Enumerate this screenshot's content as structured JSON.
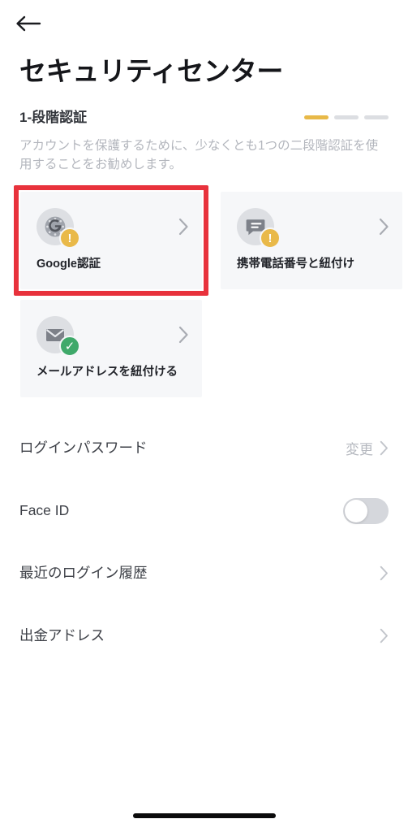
{
  "navbar": {
    "back_icon": "arrow-left-icon"
  },
  "header": {
    "title": "セキュリティセンター"
  },
  "section": {
    "title": "1-段階認証",
    "description": "アカウントを保護するために、少なくとも1つの二段階認証を使用することをお勧めします。",
    "steps": [
      {
        "state": "active",
        "color": "#e8b948"
      },
      {
        "state": "inactive",
        "color": "#dcdee2"
      },
      {
        "state": "inactive",
        "color": "#dcdee2"
      }
    ]
  },
  "auth_cards": [
    {
      "label": "Google認証",
      "icon": "authenticator-icon",
      "badge": "warning",
      "badge_mark": "!",
      "badge_color": "#e9b949",
      "highlighted": true
    },
    {
      "label": "携帯電話番号と紐付け",
      "icon": "chat-bubble-icon",
      "badge": "warning",
      "badge_mark": "!",
      "badge_color": "#e9b949",
      "highlighted": false
    },
    {
      "label": "メールアドレスを紐付ける",
      "icon": "envelope-icon",
      "badge": "verified",
      "badge_mark": "✓",
      "badge_color": "#3fa96a",
      "highlighted": false
    }
  ],
  "settings": [
    {
      "label": "ログインパスワード",
      "value": "変更",
      "control": "chevron"
    },
    {
      "label": "Face ID",
      "value": "",
      "control": "toggle",
      "toggle_on": false
    },
    {
      "label": "最近のログイン履歴",
      "value": "",
      "control": "chevron"
    },
    {
      "label": "出金アドレス",
      "value": "",
      "control": "chevron"
    }
  ],
  "footer": {
    "home_indicator": "home-indicator"
  }
}
